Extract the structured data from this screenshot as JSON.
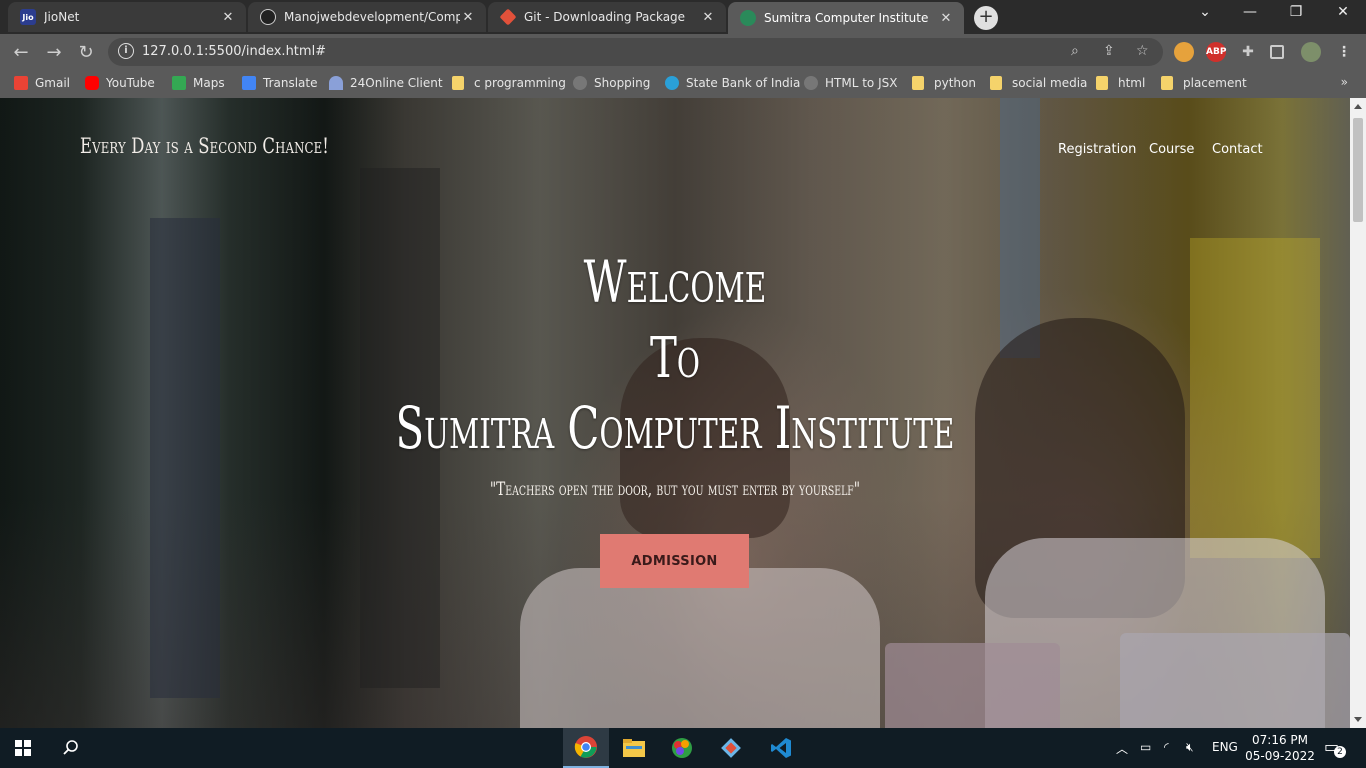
{
  "browser": {
    "tabs": [
      {
        "title": "JioNet",
        "active": false
      },
      {
        "title": "Manojwebdevelopment/Comput",
        "active": false
      },
      {
        "title": "Git - Downloading Package",
        "active": false
      },
      {
        "title": "Sumitra Computer Institute",
        "active": true
      }
    ],
    "url": "127.0.0.1:5500/index.html#",
    "bookmarks": [
      {
        "label": "Gmail",
        "icon": "gmail-icon"
      },
      {
        "label": "YouTube",
        "icon": "youtube-icon"
      },
      {
        "label": "Maps",
        "icon": "maps-icon"
      },
      {
        "label": "Translate",
        "icon": "translate-icon"
      },
      {
        "label": "24Online Client",
        "icon": "globe-icon"
      },
      {
        "label": "c programming",
        "icon": "folder-icon"
      },
      {
        "label": "Shopping",
        "icon": "globe-icon"
      },
      {
        "label": "State Bank of India",
        "icon": "sbi-icon"
      },
      {
        "label": "HTML to JSX",
        "icon": "globe-icon"
      },
      {
        "label": "python",
        "icon": "folder-icon"
      },
      {
        "label": "social media",
        "icon": "folder-icon"
      },
      {
        "label": "html",
        "icon": "folder-icon"
      },
      {
        "label": "placement",
        "icon": "folder-icon"
      }
    ],
    "extensions": {
      "abp": "ABP"
    }
  },
  "site": {
    "tagline": "Every Day is a Second Chance!",
    "nav": [
      "Registration",
      "Course",
      "Contact"
    ],
    "hero": {
      "line1": "Welcome",
      "line2": "To",
      "line3": "Sumitra Computer Institute",
      "quote": "\"Teachers open the door, but you must enter by yourself\"",
      "cta": "ADMISSION"
    }
  },
  "taskbar": {
    "language": "ENG",
    "time": "07:16 PM",
    "date": "05-09-2022",
    "notifications": "2"
  },
  "colors": {
    "accent": "#e07a72",
    "tab_active": "#5a5a5a",
    "taskbar": "#101c24"
  }
}
